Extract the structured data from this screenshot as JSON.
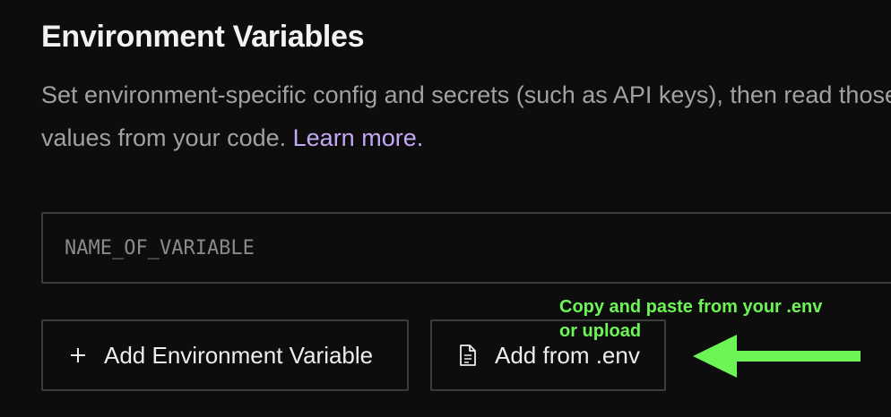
{
  "section": {
    "title": "Environment Variables",
    "description_line1": "Set environment-specific config and secrets (such as API keys), then read those",
    "description_line2": "values from your code.",
    "learn_more": "Learn more."
  },
  "input": {
    "placeholder": "NAME_OF_VARIABLE",
    "value": ""
  },
  "buttons": {
    "add_variable": {
      "label": "Add Environment Variable",
      "icon": "plus-icon"
    },
    "add_from_env": {
      "label": "Add from .env",
      "icon": "file-icon"
    }
  },
  "annotation": {
    "line1": "Copy and paste from your .env",
    "line2": "or upload",
    "color": "#6df556"
  },
  "colors": {
    "background": "#0d0d0d",
    "link": "#c4a8f5",
    "border": "#3d3d3d"
  }
}
